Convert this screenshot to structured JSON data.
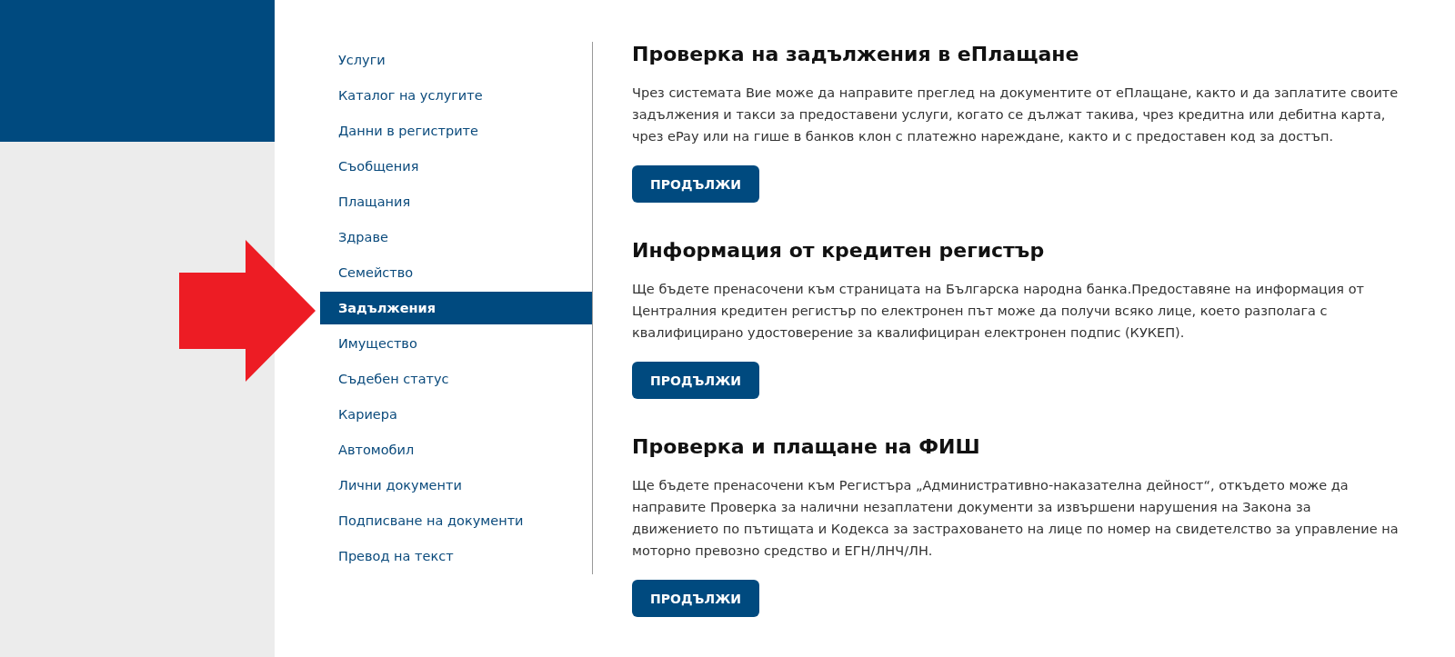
{
  "sidebar": {
    "items": [
      {
        "label": "Услуги",
        "selected": false
      },
      {
        "label": "Каталог на услугите",
        "selected": false
      },
      {
        "label": "Данни в регистрите",
        "selected": false
      },
      {
        "label": "Съобщения",
        "selected": false
      },
      {
        "label": "Плащания",
        "selected": false
      },
      {
        "label": "Здраве",
        "selected": false
      },
      {
        "label": "Семейство",
        "selected": false
      },
      {
        "label": "Задължения",
        "selected": true
      },
      {
        "label": "Имущество",
        "selected": false
      },
      {
        "label": "Съдебен статус",
        "selected": false
      },
      {
        "label": "Кариера",
        "selected": false
      },
      {
        "label": "Автомобил",
        "selected": false
      },
      {
        "label": "Лични документи",
        "selected": false
      },
      {
        "label": "Подписване на документи",
        "selected": false
      },
      {
        "label": "Превод на текст",
        "selected": false
      }
    ]
  },
  "sections": [
    {
      "title": "Проверка на задължения в еПлащане",
      "text": "Чрез системата Вие може да направите преглед на документите от еПлащане, както и да заплатите своите задължения и такси за предоставени услуги, когато се дължат такива, чрез кредитна или дебитна карта, чрез ePay или на гише в банков клон с платежно нареждане, както и с предоставен код за достъп.",
      "button": "ПРОДЪЛЖИ"
    },
    {
      "title": "Информация от кредитен регистър",
      "text": "Ще бъдете пренасочени към страницата на Българска народна банка.Предоставяне на информация от Централния кредитен регистър по електронен път може да получи всяко лице, което разполага с квалифицирано удостоверение за квалифициран електронен подпис (КУКЕП).",
      "button": "ПРОДЪЛЖИ"
    },
    {
      "title": "Проверка и плащане на ФИШ",
      "text": "Ще бъдете пренасочени към Регистъра „Административно-наказателна дейност“, откъдето може да направите Проверка за налични незаплатени документи за извършени нарушения на Закона за движението по пътищата и Кодекса за застраховането на лице по номер на свидетелство за управление на моторно превозно средство и ЕГН/ЛНЧ/ЛН.",
      "button": "ПРОДЪЛЖИ"
    }
  ]
}
